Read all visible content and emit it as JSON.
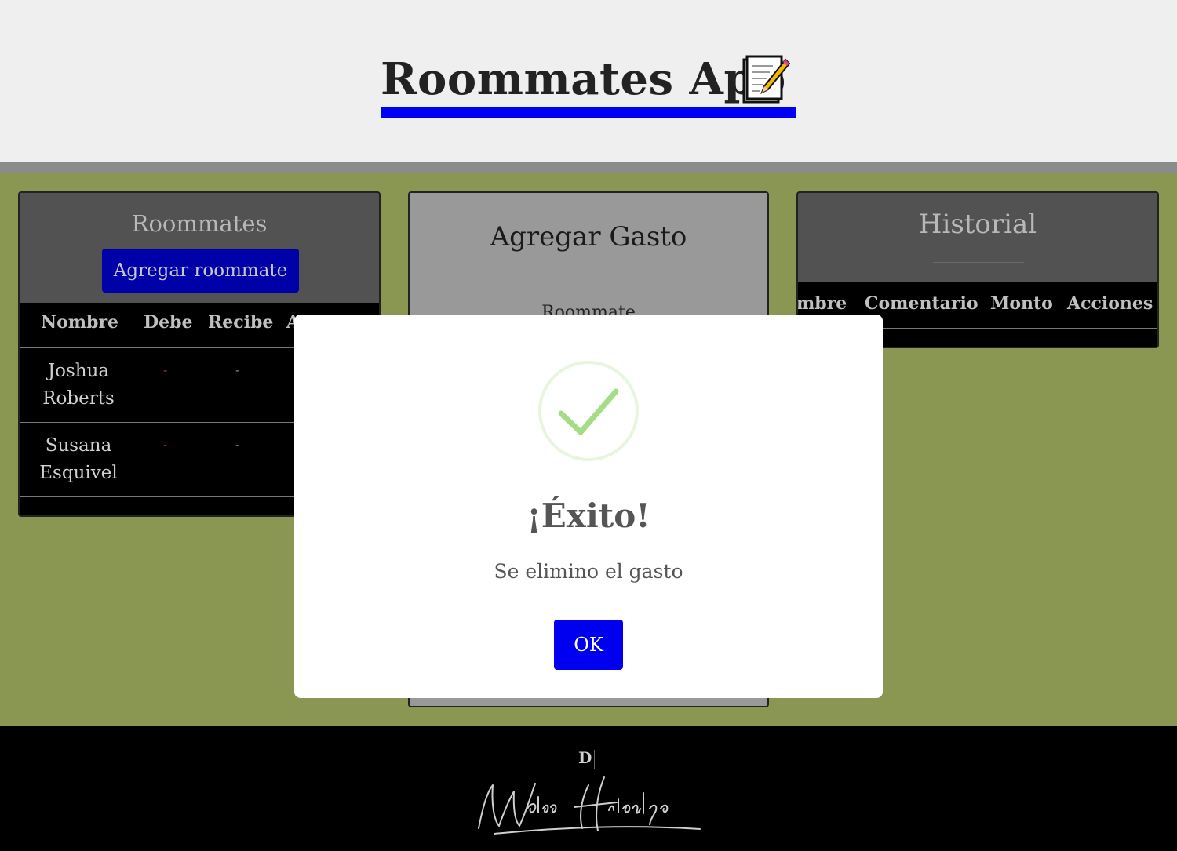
{
  "header": {
    "title": "Roommates App",
    "title_icon": "memo-icon"
  },
  "roommates_panel": {
    "title": "Roommates",
    "add_button": "Agregar roommate",
    "columns": [
      "Nombre",
      "Debe",
      "Recibe",
      "A"
    ],
    "rows": [
      {
        "name_line1": "Joshua",
        "name_line2": "Roberts",
        "debe": "-",
        "recibe": "-"
      },
      {
        "name_line1": "Susana",
        "name_line2": "Esquivel",
        "debe": "-",
        "recibe": "-"
      }
    ]
  },
  "gasto_panel": {
    "title": "Agregar Gasto",
    "roommate_label": "Roommate"
  },
  "historial_panel": {
    "title": "Historial",
    "columns": [
      "mbre",
      "Comentario",
      "Monto",
      "Acciones"
    ]
  },
  "modal": {
    "icon": "success-check-icon",
    "title": "¡Éxito!",
    "message": "Se elimino el gasto",
    "ok_label": "OK"
  },
  "footer": {
    "initial": "D",
    "signature_text": "Waldo Hidalgo"
  },
  "colors": {
    "accent_blue": "#0000f2",
    "page_green": "#8a9752",
    "success_green": "#a5dc86"
  }
}
